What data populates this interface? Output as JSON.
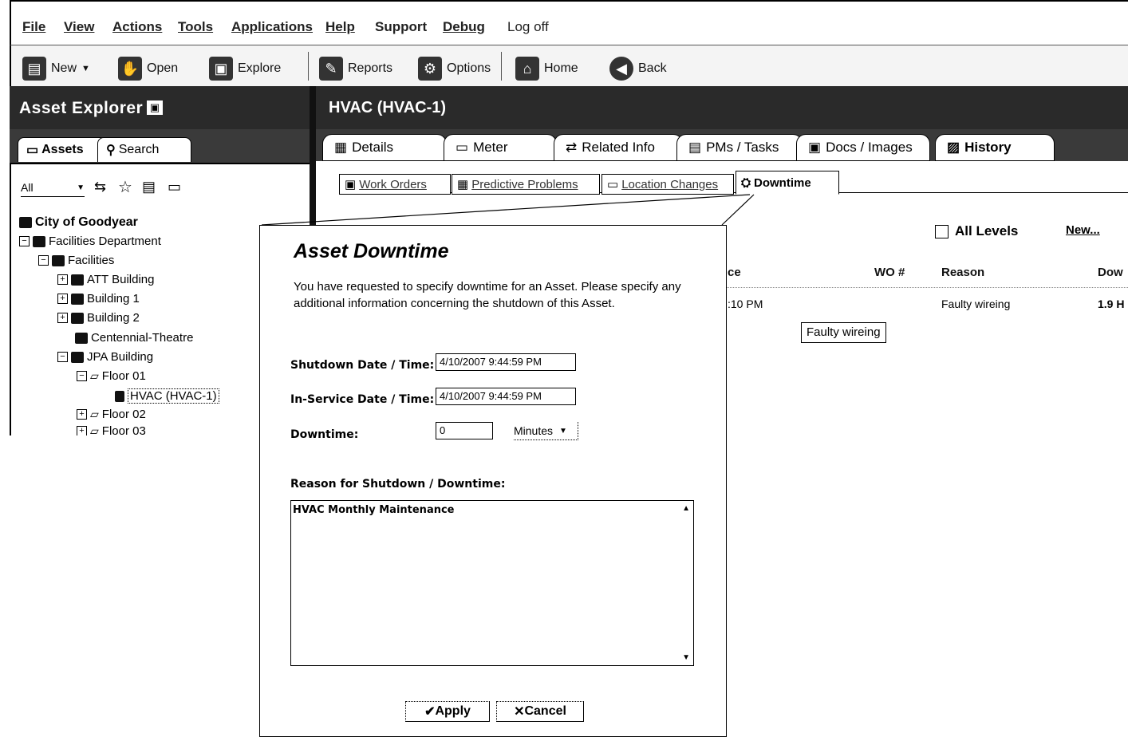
{
  "menu": [
    "File",
    "View",
    "Actions",
    "Tools",
    "Applications",
    "Help",
    "Support",
    "Debug",
    "Log off"
  ],
  "toolbar": {
    "new_label": "New",
    "open_label": "Open",
    "explore_label": "Explore",
    "reports_label": "Reports",
    "options_label": "Options",
    "home_label": "Home",
    "back_label": "Back"
  },
  "left": {
    "title": "Asset Explorer",
    "tab_assets": "Assets",
    "tab_search": "Search",
    "filter_value": "All",
    "tree": [
      {
        "label": "City of Goodyear"
      },
      {
        "label": "Facilities Department"
      },
      {
        "label": "Facilities"
      },
      {
        "label": "ATT Building"
      },
      {
        "label": "Building 1"
      },
      {
        "label": "Building 2"
      },
      {
        "label": "Centennial-Theatre"
      },
      {
        "label": "JPA Building"
      },
      {
        "label": "Floor 01"
      },
      {
        "label": "HVAC (HVAC-1)"
      },
      {
        "label": "Floor 02"
      },
      {
        "label": "Floor 03"
      }
    ]
  },
  "right": {
    "title": "HVAC  (HVAC-1)",
    "tabs": [
      "Details",
      "Meter",
      "Related Info",
      "PMs / Tasks",
      "Docs / Images",
      "History"
    ],
    "subtabs": [
      "Work Orders",
      "Predictive Problems",
      "Location Changes",
      "Downtime"
    ],
    "all_levels": "All Levels",
    "new_link": "New...",
    "columns": [
      "ce",
      "WO #",
      "Reason",
      "Dow"
    ],
    "row": {
      "time": ":10 PM",
      "reason": "Faulty wireing",
      "downtime": "1.9 H"
    },
    "tooltip": "Faulty wireing"
  },
  "dialog": {
    "title": "Asset Downtime",
    "intro": "You have requested to specify downtime for an Asset. Please specify any additional information concerning the shutdown of this Asset.",
    "shutdown_label": "Shutdown Date / Time:",
    "shutdown_value": "4/10/2007 9:44:59 PM",
    "inservice_label": "In-Service Date / Time:",
    "inservice_value": "4/10/2007 9:44:59 PM",
    "downtime_label": "Downtime:",
    "downtime_value": "0",
    "unit_value": "Minutes",
    "reason_label": "Reason for Shutdown / Downtime:",
    "reason_value": "HVAC Monthly Maintenance",
    "apply_label": "Apply",
    "cancel_label": "Cancel"
  }
}
